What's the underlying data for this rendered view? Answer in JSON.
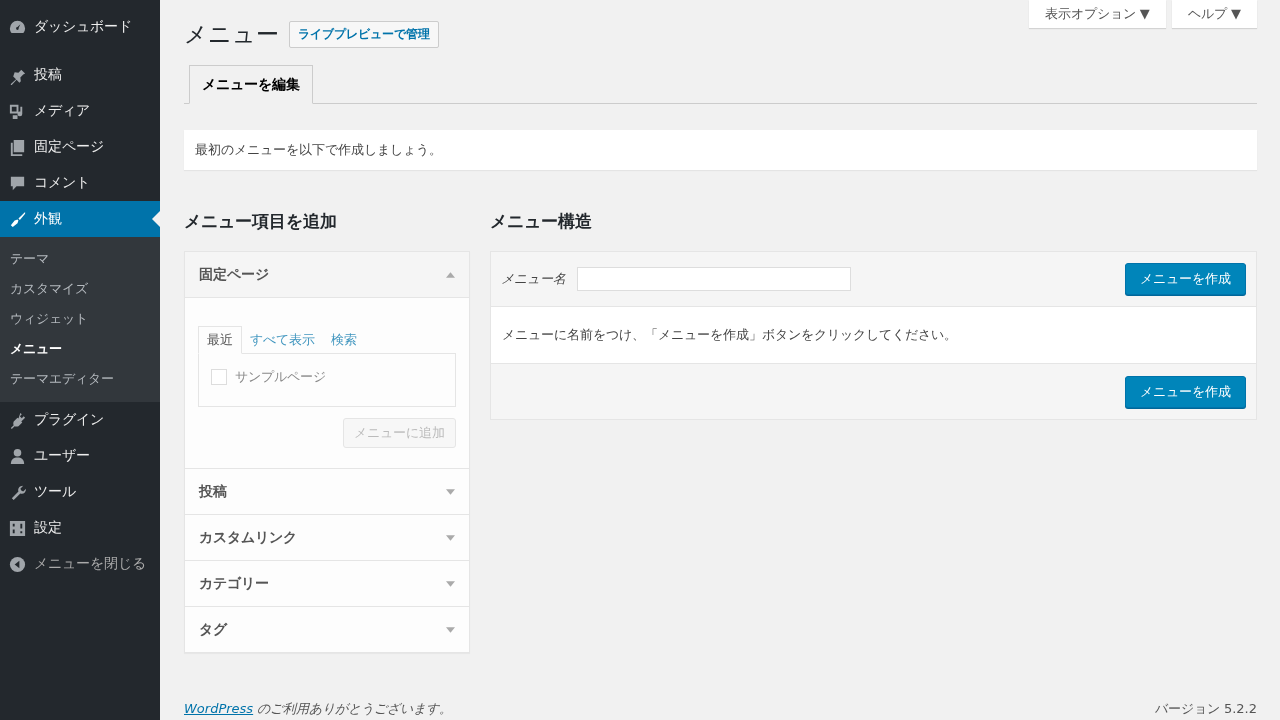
{
  "sidebar": {
    "items": [
      {
        "label": "ダッシュボード",
        "selected": false
      },
      {
        "label": "投稿",
        "selected": false
      },
      {
        "label": "メディア",
        "selected": false
      },
      {
        "label": "固定ページ",
        "selected": false
      },
      {
        "label": "コメント",
        "selected": false
      },
      {
        "label": "外観",
        "selected": true,
        "expanded": true,
        "children": [
          {
            "label": "テーマ",
            "selected": false
          },
          {
            "label": "カスタマイズ",
            "selected": false
          },
          {
            "label": "ウィジェット",
            "selected": false
          },
          {
            "label": "メニュー",
            "selected": true
          },
          {
            "label": "テーマエディター",
            "selected": false
          }
        ]
      },
      {
        "label": "プラグイン",
        "selected": false
      },
      {
        "label": "ユーザー",
        "selected": false
      },
      {
        "label": "ツール",
        "selected": false
      },
      {
        "label": "設定",
        "selected": false
      },
      {
        "label": "メニューを閉じる",
        "selected": false
      }
    ]
  },
  "top_buttons": [
    "表示オプション ▼",
    "ヘルプ ▼"
  ],
  "page_title": "メニュー",
  "title_action": "ライブプレビューで管理",
  "tabs": [
    {
      "label": "メニューを編集",
      "selected": true
    }
  ],
  "notice": "最初のメニューを以下で作成しましょう。",
  "add_items": {
    "heading": "メニュー項目を追加",
    "sections": [
      {
        "title": "固定ページ",
        "expanded": true,
        "tabs": [
          {
            "label": "最近",
            "selected": true
          },
          {
            "label": "すべて表示",
            "selected": false
          },
          {
            "label": "検索",
            "selected": false
          }
        ],
        "options": [
          {
            "label": "サンプルページ",
            "checked": false
          }
        ],
        "button": {
          "label": "メニューに追加",
          "disabled": true
        }
      },
      {
        "title": "投稿",
        "expanded": false
      },
      {
        "title": "カスタムリンク",
        "expanded": false
      },
      {
        "title": "カテゴリー",
        "expanded": false
      },
      {
        "title": "タグ",
        "expanded": false
      }
    ]
  },
  "structure": {
    "heading": "メニュー構造",
    "name_label": "メニュー名",
    "create_button_top": "メニューを作成",
    "instructions": "メニューに名前をつけ、「メニューを作成」ボタンをクリックしてください。",
    "create_button_bottom": "メニューを作成"
  },
  "footer": {
    "thanks_link": "WordPress",
    "thanks_text": " のご利用ありがとうございます。",
    "version": "バージョン 5.2.2"
  }
}
